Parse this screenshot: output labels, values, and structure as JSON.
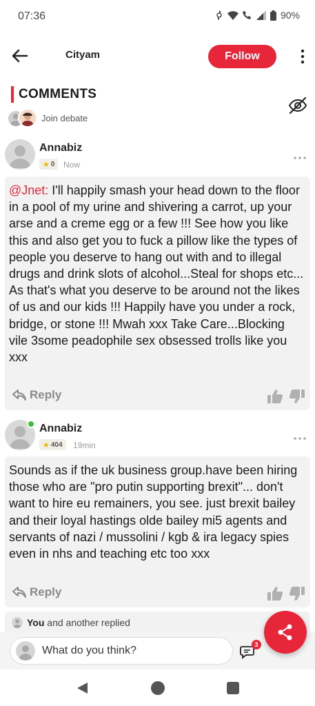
{
  "status_bar": {
    "time": "07:36",
    "battery": "90%"
  },
  "header": {
    "title": "Cityam",
    "follow_label": "Follow",
    "icons": {
      "back": "arrow-left-icon",
      "more": "more-vertical-icon"
    }
  },
  "comments_section": {
    "title": "COMMENTS",
    "join_label": "Join debate",
    "hide_icon": "eye-off-icon"
  },
  "comments": [
    {
      "author": "Annabiz",
      "karma": "0",
      "time": "Now",
      "mention": "@Jnet:",
      "body": " I'll happily smash your head down to the floor in a pool of my urine and shivering a carrot, up your arse and a creme egg or a few !!! See how you like this and also get you to fuck a pillow like the types of people you deserve to hang out with and to illegal drugs and drink slots of alcohol...Steal for shops etc... As that's what you deserve to be around not the likes of us and our kids !!! Happily have you under a rock, bridge, or stone !!! Mwah xxx Take Care...Blocking vile 3some peadophile sex obsessed trolls like you xxx",
      "reply_label": "Reply",
      "online": false
    },
    {
      "author": "Annabiz",
      "karma": "404",
      "time": "19min",
      "mention": "",
      "body": "Sounds as if the uk business group.have been hiring those who are \"pro putin supporting brexit\"... don't want to hire eu remainers, you see. just brexit bailey and their loyal hastings olde bailey mi5 agents and servants of nazi / mussolini / kgb & ira legacy spies even in nhs and teaching etc too xxx",
      "reply_label": "Reply",
      "online": true
    }
  ],
  "replies_strip": {
    "you": "You",
    "rest": " and another replied"
  },
  "composer": {
    "placeholder": "What do you think?",
    "chat_badge": "3"
  },
  "colors": {
    "accent": "#e8263a",
    "bubble": "#f2f2f2",
    "online": "#3cc13b"
  }
}
